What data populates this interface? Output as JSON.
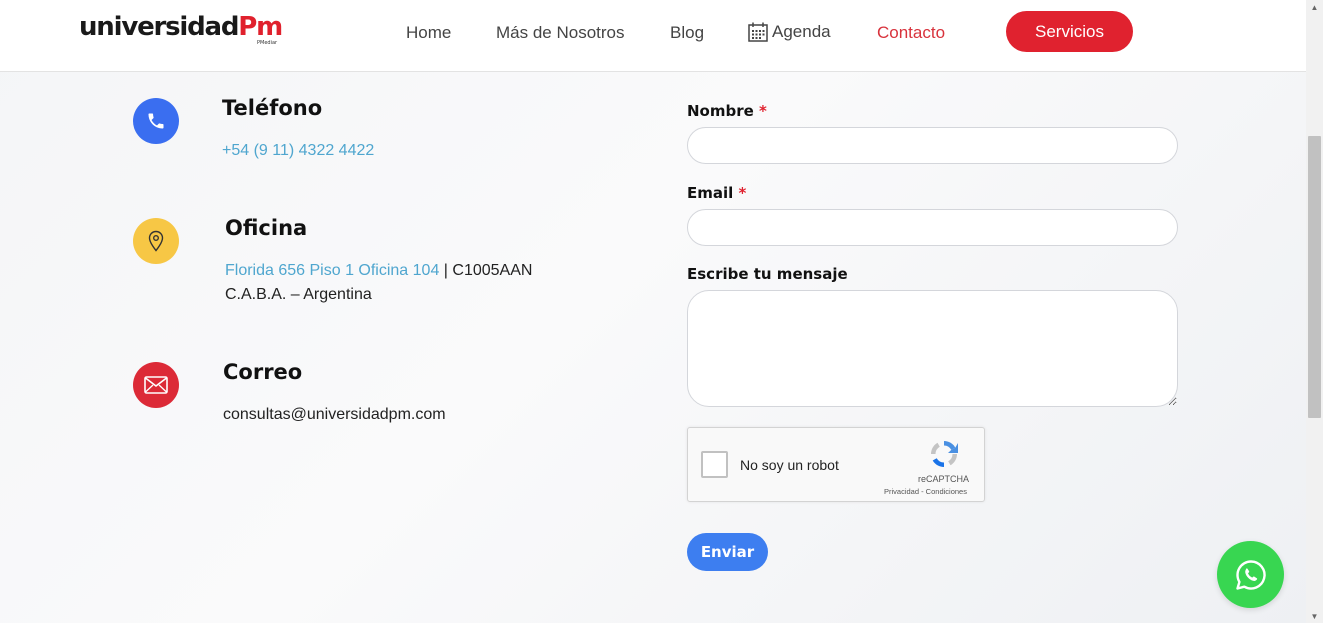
{
  "header": {
    "logo_text": "universidad",
    "logo_mark": "Pm",
    "logo_sub": "PMediar",
    "nav": {
      "home": "Home",
      "mas": "Más de Nosotros",
      "blog": "Blog",
      "agenda": "Agenda",
      "contacto": "Contacto"
    },
    "cta": "Servicios"
  },
  "contact": {
    "phone": {
      "title": "Teléfono",
      "value": "+54 (9 11) 4322 4422",
      "icon": "phone-icon"
    },
    "office": {
      "title": "Oficina",
      "address_link": "Florida 656 Piso 1 Oficina 104",
      "separator": "|",
      "postal": "C1005AAN",
      "city": "C.A.B.A. – Argentina",
      "icon": "location-pin-icon"
    },
    "mail": {
      "title": "Correo",
      "value": "consultas@universidadpm.com",
      "icon": "envelope-icon"
    }
  },
  "form": {
    "name_label": "Nombre",
    "email_label": "Email",
    "message_label": "Escribe tu mensaje",
    "required_mark": "*",
    "name_value": "",
    "email_value": "",
    "message_value": "",
    "recaptcha": {
      "label": "No soy un robot",
      "brand": "reCAPTCHA",
      "links": "Privacidad - Condiciones"
    },
    "submit": "Enviar"
  },
  "colors": {
    "brand_red": "#e0222f",
    "phone_blue": "#3a6ef0",
    "office_yellow": "#f7c745",
    "mail_red": "#dc2a37",
    "link_blue": "#4fa6cf",
    "submit_blue": "#3d7ef0",
    "whatsapp_green": "#38d651"
  },
  "floating": {
    "icon": "whatsapp-icon"
  }
}
